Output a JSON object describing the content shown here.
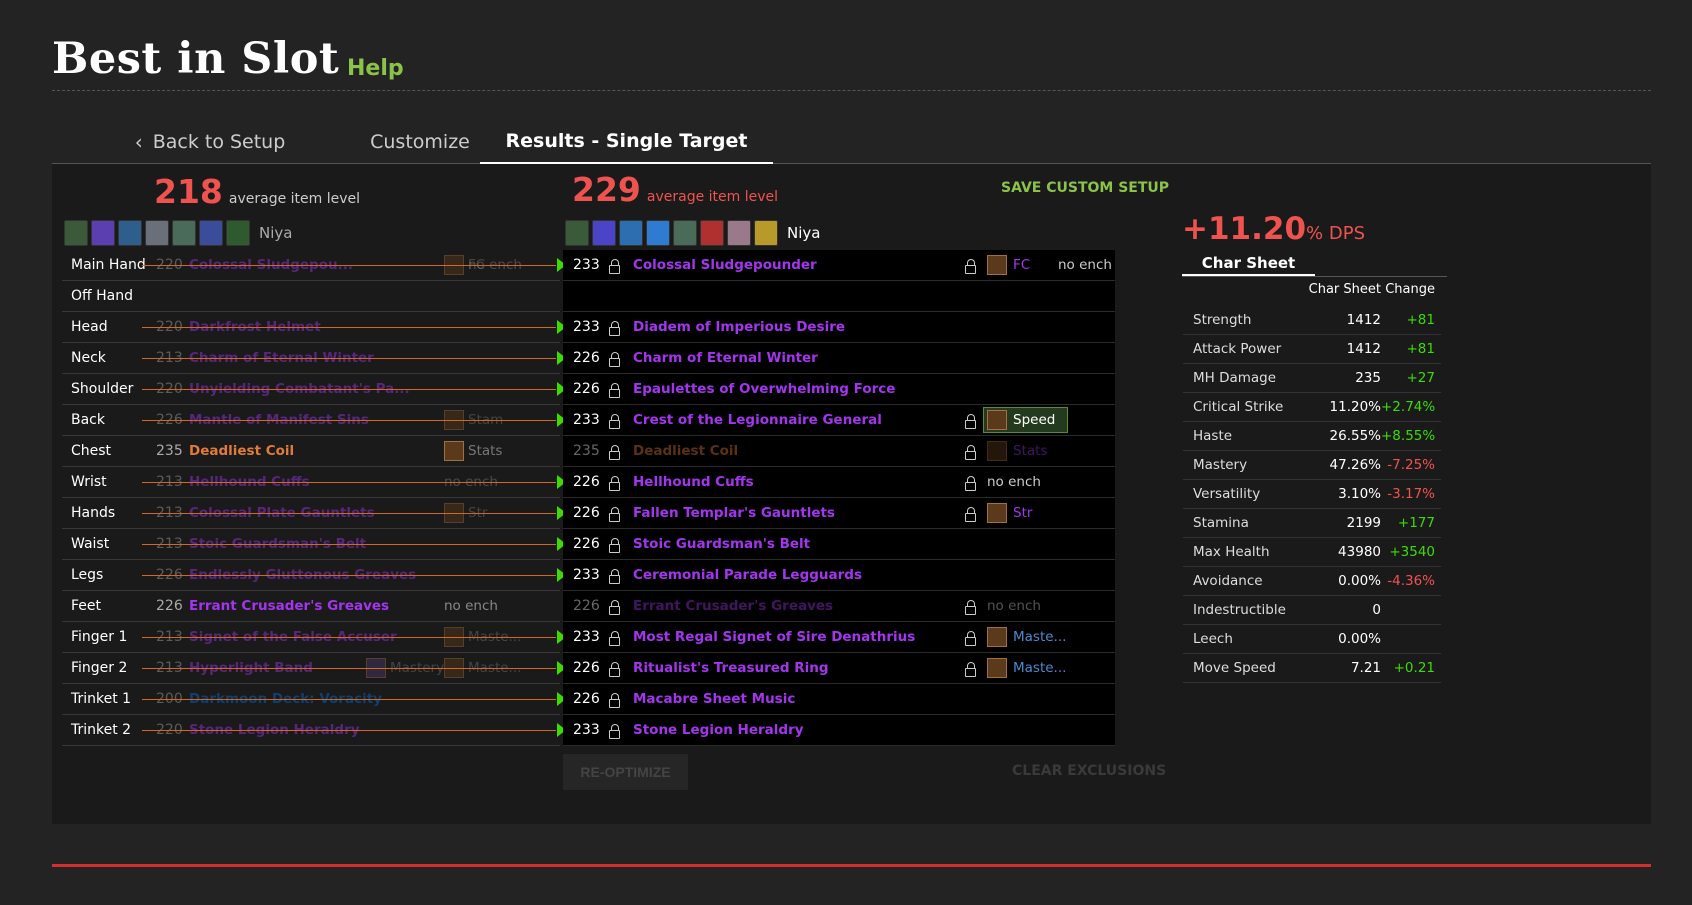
{
  "header": {
    "title": "Best in Slot",
    "help": "Help"
  },
  "tabs": [
    {
      "label": "Back to Setup"
    },
    {
      "label": "Customize"
    },
    {
      "label": "Results - Single Target"
    }
  ],
  "left": {
    "avg_ilvl": "218",
    "avg_label": "average item level",
    "character": "Niya",
    "rows": [
      {
        "slot": "Main Hand",
        "ilvl": "220",
        "name": "Colossal Sludgepou...",
        "ench": "FC",
        "ench2": "no ench",
        "color": "#a335ee",
        "changed": true
      },
      {
        "slot": "Off Hand",
        "ilvl": "",
        "name": "",
        "ench": "",
        "ench2": "",
        "color": "#a335ee",
        "changed": false
      },
      {
        "slot": "Head",
        "ilvl": "220",
        "name": "Darkfrost Helmet",
        "ench": "",
        "ench2": "",
        "color": "#a335ee",
        "changed": true
      },
      {
        "slot": "Neck",
        "ilvl": "213",
        "name": "Charm of Eternal Winter",
        "ench": "",
        "ench2": "",
        "color": "#a335ee",
        "changed": true
      },
      {
        "slot": "Shoulder",
        "ilvl": "220",
        "name": "Unyielding Combatant's Pa...",
        "ench": "",
        "ench2": "",
        "color": "#a335ee",
        "changed": true
      },
      {
        "slot": "Back",
        "ilvl": "226",
        "name": "Mantle of Manifest Sins",
        "ench": "Stam",
        "ench2": "",
        "color": "#a335ee",
        "changed": true
      },
      {
        "slot": "Chest",
        "ilvl": "235",
        "name": "Deadliest Coil",
        "ench": "Stats",
        "ench2": "",
        "color": "#e07b39",
        "changed": false
      },
      {
        "slot": "Wrist",
        "ilvl": "213",
        "name": "Hellhound Cuffs",
        "ench": "",
        "ench2": "no ench",
        "color": "#a335ee",
        "changed": true
      },
      {
        "slot": "Hands",
        "ilvl": "213",
        "name": "Colossal Plate Gauntlets",
        "ench": "Str",
        "ench2": "",
        "color": "#a335ee",
        "changed": true
      },
      {
        "slot": "Waist",
        "ilvl": "213",
        "name": "Stoic Guardsman's Belt",
        "ench": "",
        "ench2": "",
        "color": "#a335ee",
        "changed": true
      },
      {
        "slot": "Legs",
        "ilvl": "226",
        "name": "Endlessly Gluttonous Greaves",
        "ench": "",
        "ench2": "",
        "color": "#a335ee",
        "changed": true
      },
      {
        "slot": "Feet",
        "ilvl": "226",
        "name": "Errant Crusader's Greaves",
        "ench": "",
        "ench2": "no ench",
        "color": "#a335ee",
        "changed": false
      },
      {
        "slot": "Finger 1",
        "ilvl": "213",
        "name": "Signet of the False Accuser",
        "ench": "Maste...",
        "ench2": "",
        "color": "#a335ee",
        "changed": true
      },
      {
        "slot": "Finger 2",
        "ilvl": "213",
        "name": "Hyperlight Band",
        "ench": "Maste...",
        "ench2": "Mastery",
        "color": "#a335ee",
        "changed": true
      },
      {
        "slot": "Trinket 1",
        "ilvl": "200",
        "name": "Darkmoon Deck: Voracity",
        "ench": "",
        "ench2": "",
        "color": "#0070dd",
        "changed": true
      },
      {
        "slot": "Trinket 2",
        "ilvl": "220",
        "name": "Stone Legion Heraldry",
        "ench": "",
        "ench2": "",
        "color": "#a335ee",
        "changed": true
      }
    ]
  },
  "mid": {
    "avg_ilvl": "229",
    "avg_label": "average item level",
    "character": "Niya",
    "save_label": "SAVE CUSTOM SETUP",
    "rows": [
      {
        "ilvl": "233",
        "name": "Colossal Sludgepounder",
        "ench": "FC",
        "ench2": "no ench",
        "color": "#a335ee",
        "dim": false,
        "elock": true
      },
      {
        "ilvl": "",
        "name": "",
        "ench": "",
        "ench2": "",
        "color": "#a335ee",
        "dim": false,
        "elock": false
      },
      {
        "ilvl": "233",
        "name": "Diadem of Imperious Desire",
        "ench": "",
        "ench2": "",
        "color": "#a335ee",
        "dim": false,
        "elock": false
      },
      {
        "ilvl": "226",
        "name": "Charm of Eternal Winter",
        "ench": "",
        "ench2": "",
        "color": "#a335ee",
        "dim": false,
        "elock": false
      },
      {
        "ilvl": "226",
        "name": "Epaulettes of Overwhelming Force",
        "ench": "",
        "ench2": "",
        "color": "#a335ee",
        "dim": false,
        "elock": false
      },
      {
        "ilvl": "233",
        "name": "Crest of the Legionnaire General",
        "ench": "Speed",
        "ench2": "",
        "color": "#a335ee",
        "dim": false,
        "elock": true,
        "highlight": true
      },
      {
        "ilvl": "235",
        "name": "Deadliest Coil",
        "ench": "Stats",
        "ench2": "",
        "color": "#e07b39",
        "dim": true,
        "elock": true
      },
      {
        "ilvl": "226",
        "name": "Hellhound Cuffs",
        "ench": "",
        "ench2": "no ench",
        "color": "#a335ee",
        "dim": false,
        "elock": true
      },
      {
        "ilvl": "226",
        "name": "Fallen Templar's Gauntlets",
        "ench": "Str",
        "ench2": "",
        "color": "#a335ee",
        "dim": false,
        "elock": true
      },
      {
        "ilvl": "226",
        "name": "Stoic Guardsman's Belt",
        "ench": "",
        "ench2": "",
        "color": "#a335ee",
        "dim": false,
        "elock": false
      },
      {
        "ilvl": "233",
        "name": "Ceremonial Parade Legguards",
        "ench": "",
        "ench2": "",
        "color": "#a335ee",
        "dim": false,
        "elock": false
      },
      {
        "ilvl": "226",
        "name": "Errant Crusader's Greaves",
        "ench": "",
        "ench2": "no ench",
        "color": "#a335ee",
        "dim": true,
        "elock": true
      },
      {
        "ilvl": "233",
        "name": "Most Regal Signet of Sire Denathrius",
        "ench": "Maste...",
        "ench2": "",
        "color": "#a335ee",
        "dim": false,
        "elock": true
      },
      {
        "ilvl": "226",
        "name": "Ritualist's Treasured Ring",
        "ench": "Maste...",
        "ench2": "",
        "color": "#a335ee",
        "dim": false,
        "elock": true
      },
      {
        "ilvl": "226",
        "name": "Macabre Sheet Music",
        "ench": "",
        "ench2": "",
        "color": "#a335ee",
        "dim": false,
        "elock": false
      },
      {
        "ilvl": "233",
        "name": "Stone Legion Heraldry",
        "ench": "",
        "ench2": "",
        "color": "#a335ee",
        "dim": false,
        "elock": false
      }
    ],
    "reoptimize": "RE-OPTIMIZE",
    "clear": "CLEAR EXCLUSIONS"
  },
  "right": {
    "dps_value": "+11.20",
    "dps_unit": "% DPS",
    "tab": "Char Sheet",
    "col1": "Char Sheet",
    "col2": "Change",
    "stats": [
      {
        "name": "Strength",
        "value": "1412",
        "change": "+81",
        "sign": "pos"
      },
      {
        "name": "Attack Power",
        "value": "1412",
        "change": "+81",
        "sign": "pos"
      },
      {
        "name": "MH Damage",
        "value": "235",
        "change": "+27",
        "sign": "pos"
      },
      {
        "name": "Critical Strike",
        "value": "11.20%",
        "change": "+2.74%",
        "sign": "pos"
      },
      {
        "name": "Haste",
        "value": "26.55%",
        "change": "+8.55%",
        "sign": "pos"
      },
      {
        "name": "Mastery",
        "value": "47.26%",
        "change": "-7.25%",
        "sign": "neg"
      },
      {
        "name": "Versatility",
        "value": "3.10%",
        "change": "-3.17%",
        "sign": "neg"
      },
      {
        "name": "Stamina",
        "value": "2199",
        "change": "+177",
        "sign": "pos"
      },
      {
        "name": "Max Health",
        "value": "43980",
        "change": "+3540",
        "sign": "pos"
      },
      {
        "name": "Avoidance",
        "value": "0.00%",
        "change": "-4.36%",
        "sign": "neg"
      },
      {
        "name": "Indestructible",
        "value": "0",
        "change": "",
        "sign": "pos"
      },
      {
        "name": "Leech",
        "value": "0.00%",
        "change": "",
        "sign": "pos"
      },
      {
        "name": "Move Speed",
        "value": "7.21",
        "change": "+0.21",
        "sign": "pos"
      }
    ]
  },
  "icon_colors_left": [
    "#3a5a3a",
    "#5b3fb0",
    "#2d5e8c",
    "#6a6f7a",
    "#4a6a5a",
    "#3b4d9a",
    "#2f5a2f"
  ],
  "icon_colors_mid": [
    "#3a5a3a",
    "#4a44c8",
    "#2d6eb0",
    "#2f7bd0",
    "#4a6a5a",
    "#b03030",
    "#9a7a8a",
    "#b89a2a"
  ]
}
